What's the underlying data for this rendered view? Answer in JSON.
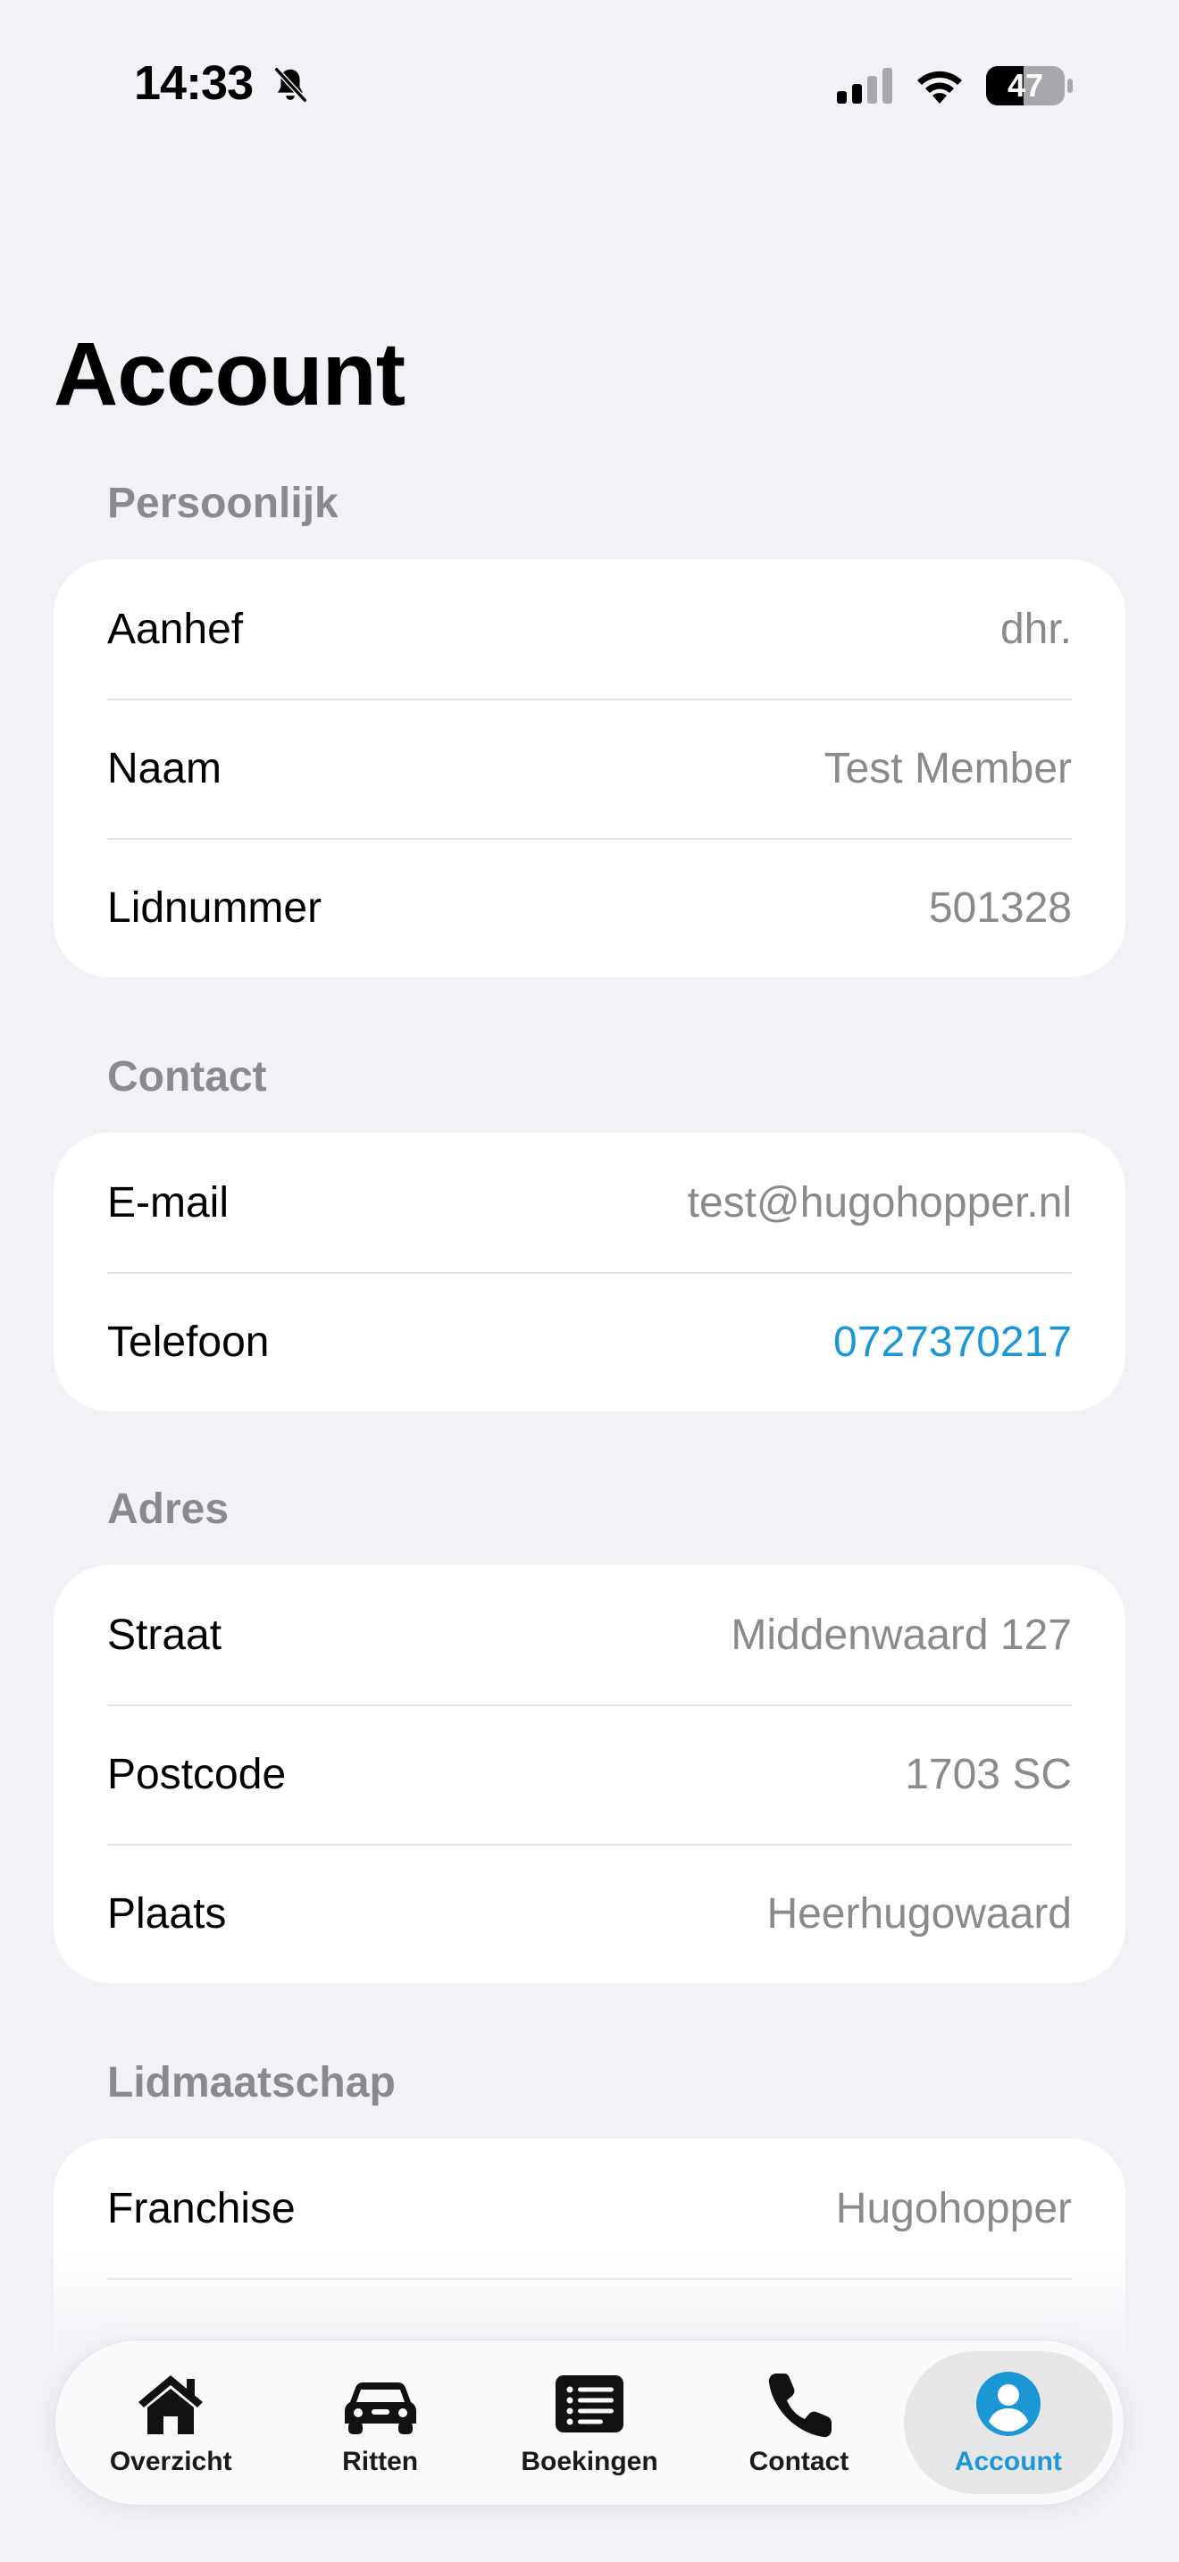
{
  "status": {
    "time": "14:33",
    "battery": "47"
  },
  "page": {
    "title": "Account"
  },
  "sections": [
    {
      "header": "Persoonlijk",
      "rows": [
        {
          "label": "Aanhef",
          "value": "dhr."
        },
        {
          "label": "Naam",
          "value": "Test Member"
        },
        {
          "label": "Lidnummer",
          "value": "501328"
        }
      ]
    },
    {
      "header": "Contact",
      "rows": [
        {
          "label": "E-mail",
          "value": "test@hugohopper.nl"
        },
        {
          "label": "Telefoon",
          "value": "0727370217"
        }
      ]
    },
    {
      "header": "Adres",
      "rows": [
        {
          "label": "Straat",
          "value": "Middenwaard 127"
        },
        {
          "label": "Postcode",
          "value": "1703 SC"
        },
        {
          "label": "Plaats",
          "value": "Heerhugowaard"
        }
      ]
    },
    {
      "header": "Lidmaatschap",
      "rows": [
        {
          "label": "Franchise",
          "value": "Hugohopper"
        }
      ]
    }
  ],
  "tabs": [
    {
      "label": "Overzicht",
      "icon": "house-icon"
    },
    {
      "label": "Ritten",
      "icon": "car-icon"
    },
    {
      "label": "Boekingen",
      "icon": "list-icon"
    },
    {
      "label": "Contact",
      "icon": "phone-icon"
    },
    {
      "label": "Account",
      "icon": "person-circle-icon",
      "active": true
    }
  ],
  "colors": {
    "accent": "#1c97d6",
    "background": "#f1f1f6",
    "secondary_text": "#8a8a8e"
  }
}
